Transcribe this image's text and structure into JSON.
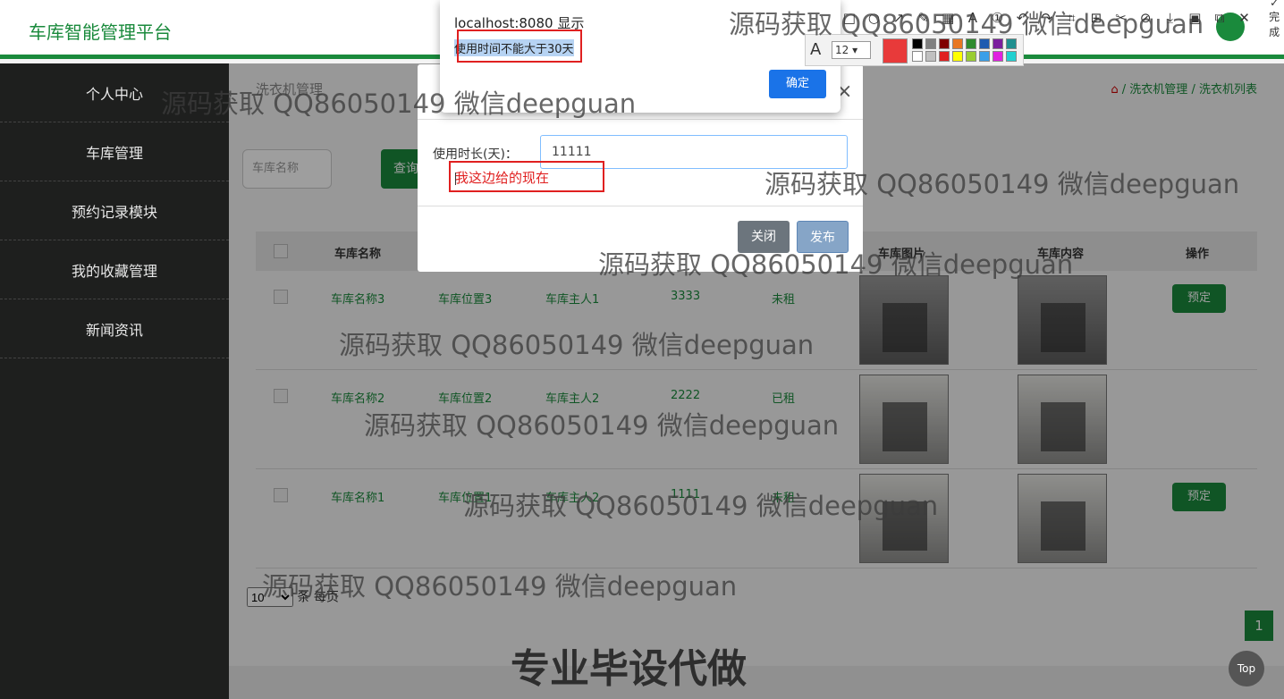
{
  "header": {
    "title": "车库智能管理平台"
  },
  "sidebar": {
    "items": [
      {
        "label": "个人中心"
      },
      {
        "label": "车库管理"
      },
      {
        "label": "预约记录模块"
      },
      {
        "label": "我的收藏管理"
      },
      {
        "label": "新闻资讯"
      }
    ]
  },
  "main": {
    "page_title": "洗衣机管理",
    "breadcrumb": {
      "separator": "/",
      "item1": "洗衣机管理",
      "item2": "洗衣机列表"
    },
    "search_placeholder": "车库名称",
    "search_button": "查询",
    "table": {
      "headers": [
        "车库名称",
        "车库图片",
        "车库内容",
        "操作"
      ],
      "rows": [
        {
          "name": "车库名称3",
          "location": "车库位置3",
          "owner": "车库主人1",
          "price": "3333",
          "status": "未租",
          "action": "预定"
        },
        {
          "name": "车库名称2",
          "location": "车库位置2",
          "owner": "车库主人2",
          "price": "2222",
          "status": "已租",
          "action": ""
        },
        {
          "name": "车库名称1",
          "location": "车库位置1",
          "owner": "车库主人2",
          "price": "1111",
          "status": "未租",
          "action": "预定"
        }
      ]
    },
    "pager": {
      "page_size": "10",
      "suffix": "条 每页",
      "current_page": "1"
    }
  },
  "modal": {
    "field_label": "使用时长(天)：",
    "field_value": "11111",
    "close_button": "关闭",
    "publish_button": "发布",
    "close_x": "×"
  },
  "alert": {
    "origin": "localhost:8080 显示",
    "message": "使用时间不能大于30天",
    "ok_button": "确定"
  },
  "annotation": {
    "text": "我这边给的现在"
  },
  "toolbar": {
    "font_glyph": "A",
    "font_size": "12",
    "done_label": "完成",
    "colors": [
      "#000000",
      "#808080",
      "#800000",
      "#e87722",
      "#2e8b2e",
      "#1e5bb0",
      "#7b1e9e",
      "#1f8f8f",
      "#ffffff",
      "#c0c0c0",
      "#e02020",
      "#ffff00",
      "#9acd32",
      "#3a9fe8",
      "#e020e0",
      "#20d0d0"
    ]
  },
  "watermark": {
    "text": "源码获取 QQ86050149 微信deepguan",
    "big": "专业毕设代做"
  },
  "top_button": "Top"
}
